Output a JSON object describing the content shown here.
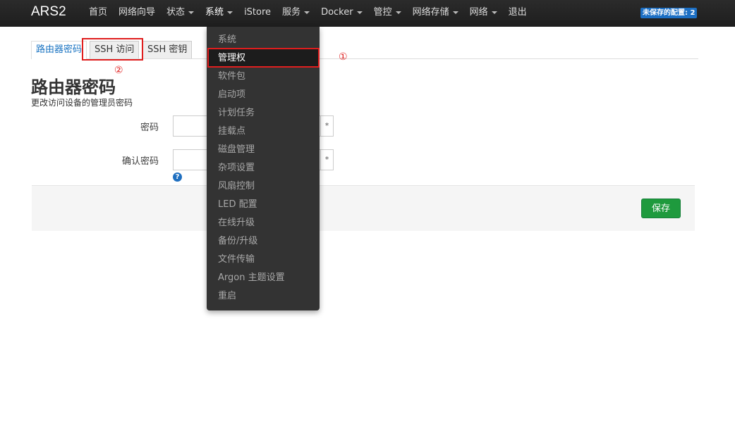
{
  "navbar": {
    "brand": "ARS2",
    "items": [
      {
        "label": "首页",
        "has_caret": false
      },
      {
        "label": "网络向导",
        "has_caret": false
      },
      {
        "label": "状态",
        "has_caret": true
      },
      {
        "label": "系统",
        "has_caret": true
      },
      {
        "label": "iStore",
        "has_caret": false
      },
      {
        "label": "服务",
        "has_caret": true
      },
      {
        "label": "Docker",
        "has_caret": true
      },
      {
        "label": "管控",
        "has_caret": true
      },
      {
        "label": "网络存储",
        "has_caret": true
      },
      {
        "label": "网络",
        "has_caret": true
      },
      {
        "label": "退出",
        "has_caret": false
      }
    ],
    "unsaved_badge": "未保存的配置: 2"
  },
  "tabs": [
    "路由器密码",
    "SSH 访问",
    "SSH 密钥"
  ],
  "annotations": {
    "one": "①",
    "two": "②"
  },
  "page": {
    "title": "路由器密码",
    "description": "更改访问设备的管理员密码",
    "password_label": "密码",
    "confirm_label": "确认密码",
    "reveal_symbol": "*",
    "help_symbol": "?",
    "save_label": "保存"
  },
  "dropdown": {
    "items": [
      "系统",
      "管理权",
      "软件包",
      "启动项",
      "计划任务",
      "挂载点",
      "磁盘管理",
      "杂项设置",
      "风扇控制",
      "LED 配置",
      "在线升级",
      "备份/升级",
      "文件传输",
      "Argon 主题设置",
      "重启"
    ],
    "current": "管理权"
  },
  "colors": {
    "navbar_bg": "#232323",
    "dropdown_bg": "#333333",
    "link_blue": "#1b74c2",
    "save_green": "#1e9a3d",
    "badge_blue": "#1c6fc4",
    "annotation_red": "#e01e1e"
  }
}
